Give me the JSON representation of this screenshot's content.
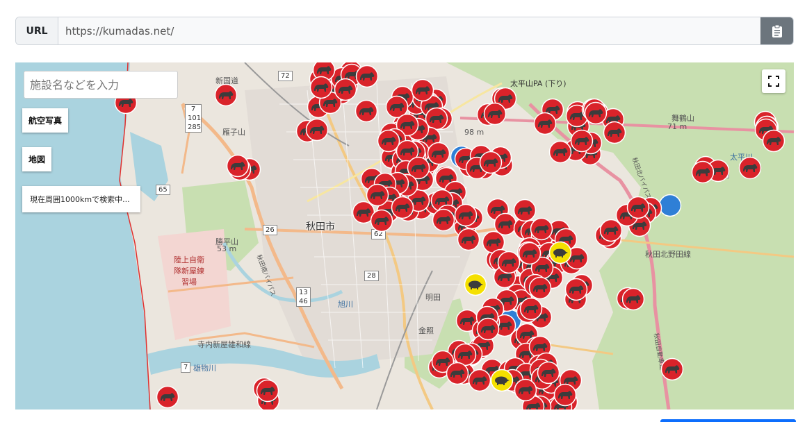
{
  "url_bar": {
    "label": "URL",
    "value": "https://kumadas.net/"
  },
  "map": {
    "search_placeholder": "施設名などを入力",
    "buttons": {
      "aerial": "航空写真",
      "map": "地図"
    },
    "status": "現在周囲1000kmで検索中...",
    "labels": {
      "city": "秋田市",
      "place_names": [
        "勝平山",
        "53 m",
        "雁子山",
        "陸上自衛隊新屋練習場",
        "太平山PA (下り)",
        "舞鶴山",
        "71 m",
        "98 m",
        "新国道",
        "秋田北野田線",
        "寺内新屋雄和線",
        "雄物川",
        "金照",
        "明田",
        "旭川",
        "秋田北バイパス",
        "秋田南バイパス",
        "太平川",
        "秋田自動車道"
      ],
      "routes": [
        "72",
        "7",
        "101",
        "285",
        "65",
        "26",
        "62",
        "28",
        "13",
        "46",
        "28",
        "7"
      ]
    },
    "marker_types": [
      "bear",
      "boar",
      "other"
    ],
    "colors": {
      "bear_marker": "#d9232a",
      "boar_marker": "#f5e000",
      "other_marker": "#2f7fd6",
      "sea": "#aad3df",
      "forest": "#c8dfb1",
      "land": "#ebe6de"
    }
  }
}
